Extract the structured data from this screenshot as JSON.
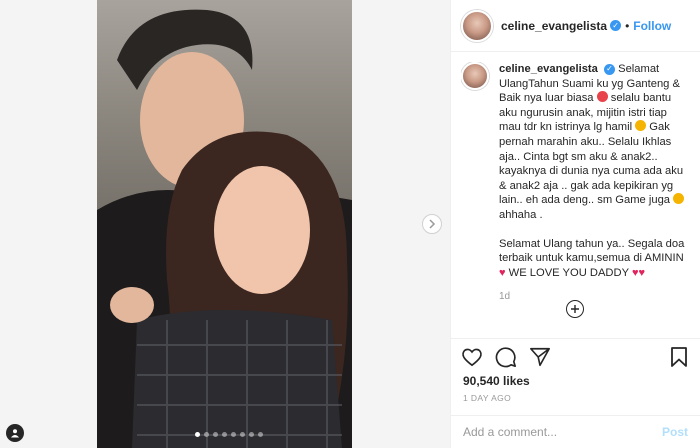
{
  "post": {
    "username": "celine_evangelista",
    "verified": true,
    "separator": "•",
    "follow_label": "Follow",
    "carousel": {
      "dot_count": 8,
      "active_index": 0
    }
  },
  "caption": {
    "username": "celine_evangelista",
    "paragraph1_a": "Selamat UlangTahun Suami ku yg Ganteng & Baik nya luar biasa",
    "paragraph1_b": "selalu bantu aku ngurusin anak, mijitin istri tiap mau tdr kn istrinya lg hamil",
    "paragraph1_c": "Gak pernah marahin aku.. Selalu Ikhlas aja.. Cinta bgt sm aku & anak2.. kayaknya di dunia nya cuma ada aku & anak2 aja .. gak ada kepikiran yg lain.. eh ada deng.. sm Game juga",
    "paragraph1_d": "ahhaha .",
    "paragraph2_a": "Selamat Ulang tahun ya.. Segala doa terbaik untuk kamu,semua di AMININ",
    "paragraph2_b": "WE LOVE YOU DADDY",
    "time": "1d"
  },
  "actions": {
    "like_icon": "heart-icon",
    "comment_icon": "comment-icon",
    "share_icon": "share-icon",
    "save_icon": "bookmark-icon"
  },
  "likes": "90,540 likes",
  "date": "1 DAY AGO",
  "comment_box": {
    "placeholder": "Add a comment...",
    "post_label": "Post"
  }
}
